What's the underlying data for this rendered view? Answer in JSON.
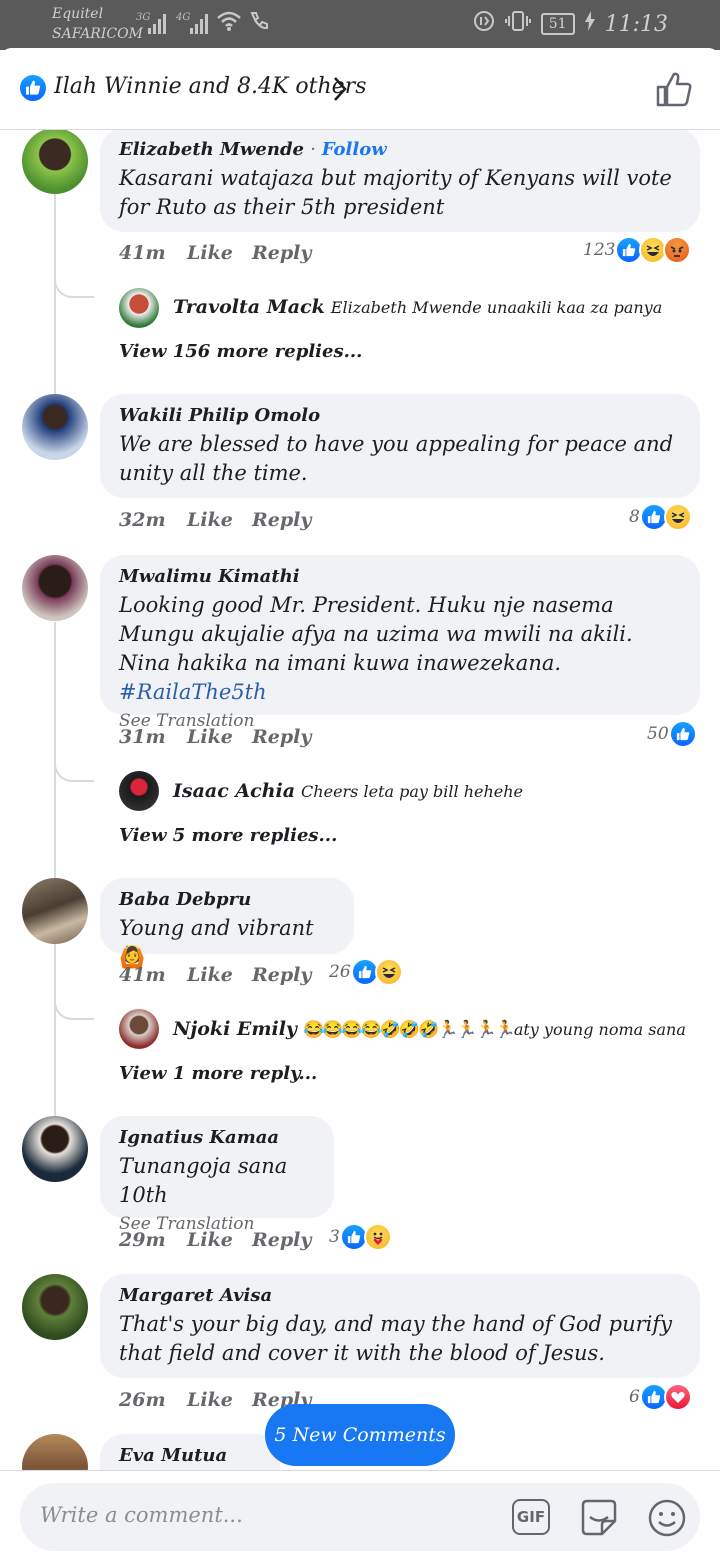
{
  "status_bar": {
    "carrier_line1": "Equitel",
    "carrier_line2": "SAFARICOM",
    "sig1_label": "3G",
    "sig2_label": "4G",
    "battery": "51",
    "time": "11:13"
  },
  "header": {
    "reactions_text": "Ilah Winnie and 8.4K others"
  },
  "comments": [
    {
      "author": "Elizabeth Mwende",
      "follow_label": "Follow",
      "text": "Kasarani watajaza but majority of Kenyans will vote for Ruto as their 5th president",
      "time": "41m",
      "like_label": "Like",
      "reply_label": "Reply",
      "reaction_count": "123",
      "reactions": [
        "like-icon",
        "haha-icon",
        "angry-icon"
      ],
      "reply": {
        "author": "Travolta Mack",
        "text": "Elizabeth Mwende unaakili kaa za panya"
      },
      "view_more": "View 156 more replies..."
    },
    {
      "author": "Wakili Philip Omolo",
      "text": "We are blessed to have you appealing for peace and unity all the time.",
      "time": "32m",
      "like_label": "Like",
      "reply_label": "Reply",
      "reaction_count": "8",
      "reactions": [
        "like-icon",
        "haha-icon"
      ]
    },
    {
      "author": "Mwalimu Kimathi",
      "text": "Looking good Mr. President. Huku nje nasema Mungu akujalie afya na uzima wa mwili na akili. Nina hakika na imani kuwa inawezekana.",
      "hashtag": "#RailaThe5th",
      "see_translation": "See Translation",
      "time": "31m",
      "like_label": "Like",
      "reply_label": "Reply",
      "reaction_count": "50",
      "reactions": [
        "like-icon"
      ],
      "reply": {
        "author": "Isaac Achia",
        "text": "Cheers leta pay bill hehehe"
      },
      "view_more": "View 5 more replies..."
    },
    {
      "author": "Baba Debpru",
      "text": "Young and vibrant",
      "time": "41m",
      "like_label": "Like",
      "reply_label": "Reply",
      "reaction_count": "26",
      "reactions": [
        "like-icon",
        "haha-icon"
      ],
      "reply": {
        "author": "Njoki Emily",
        "emojis": "😂😂😂😂🤣🤣🤣🏃🏃🏃🏃",
        "text": "aty young noma sana"
      },
      "view_more": "View 1 more reply..."
    },
    {
      "author": "Ignatius Kamaa",
      "text": "Tunangoja sana 10th",
      "see_translation": "See Translation",
      "time": "29m",
      "like_label": "Like",
      "reply_label": "Reply",
      "reaction_count": "3",
      "reactions": [
        "like-icon",
        "care-icon"
      ]
    },
    {
      "author": "Margaret Avisa",
      "text": "That's your big day, and may the hand of God purify that field and cover it with the blood of Jesus.",
      "time": "26m",
      "like_label": "Like",
      "reply_label": "Reply",
      "reaction_count": "6",
      "reactions": [
        "like-icon",
        "love-icon"
      ]
    },
    {
      "author": "Eva Mutua"
    }
  ],
  "new_comments_label": "5 New Comments",
  "composer": {
    "placeholder": "Write a comment...",
    "gif_label": "GIF"
  },
  "colors": {
    "accent": "#1877f2",
    "bubble": "#f0f2f5",
    "muted": "#65676b"
  }
}
